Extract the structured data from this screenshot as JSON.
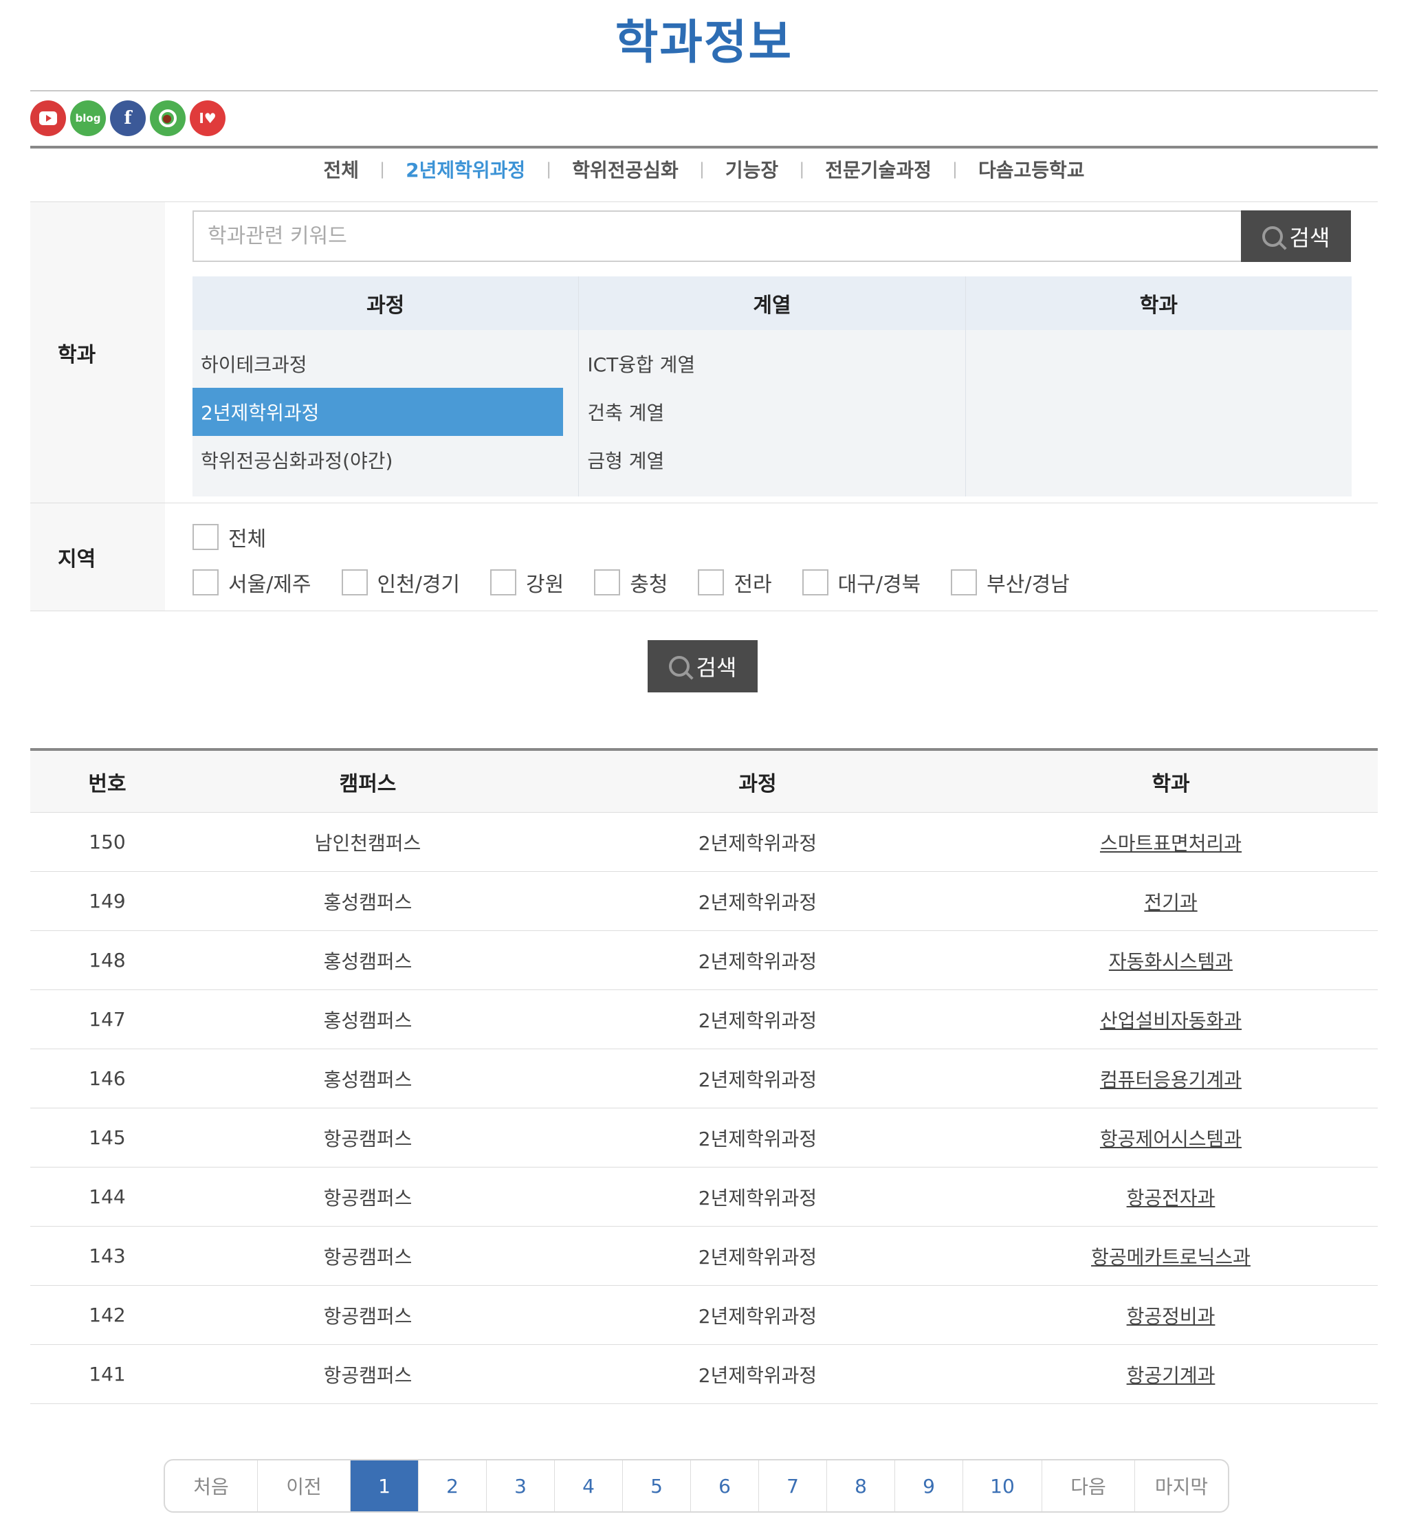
{
  "page": {
    "title": "학과정보"
  },
  "sns": [
    "youtube-icon",
    "blog-icon",
    "facebook-icon",
    "kakaostory-icon",
    "ilove-icon"
  ],
  "sns_labels": {
    "blog": "blog",
    "facebook": "f",
    "ilove": "I♥"
  },
  "tabs": [
    {
      "label": "전체",
      "active": false
    },
    {
      "label": "2년제학위과정",
      "active": true
    },
    {
      "label": "학위전공심화",
      "active": false
    },
    {
      "label": "기능장",
      "active": false
    },
    {
      "label": "전문기술과정",
      "active": false
    },
    {
      "label": "다솜고등학교",
      "active": false
    }
  ],
  "tab_separator": "|",
  "filter": {
    "dept_label": "학과",
    "region_label": "지역",
    "keyword_placeholder": "학과관련 키워드",
    "search_label": "검색",
    "columns": {
      "course": "과정",
      "field": "계열",
      "dept": "학과"
    },
    "courses": [
      {
        "label": "하이테크과정",
        "selected": false
      },
      {
        "label": "2년제학위과정",
        "selected": true
      },
      {
        "label": "학위전공심화과정(야간)",
        "selected": false
      }
    ],
    "fields": [
      "ICT융합 계열",
      "건축 계열",
      "금형 계열"
    ],
    "regions_all": "전체",
    "regions": [
      "서울/제주",
      "인천/경기",
      "강원",
      "충청",
      "전라",
      "대구/경북",
      "부산/경남"
    ]
  },
  "main_search_label": "검색",
  "table": {
    "headers": {
      "no": "번호",
      "campus": "캠퍼스",
      "course": "과정",
      "dept": "학과"
    },
    "rows": [
      {
        "no": "150",
        "campus": "남인천캠퍼스",
        "course": "2년제학위과정",
        "dept": "스마트표면처리과"
      },
      {
        "no": "149",
        "campus": "홍성캠퍼스",
        "course": "2년제학위과정",
        "dept": "전기과"
      },
      {
        "no": "148",
        "campus": "홍성캠퍼스",
        "course": "2년제학위과정",
        "dept": "자동화시스템과"
      },
      {
        "no": "147",
        "campus": "홍성캠퍼스",
        "course": "2년제학위과정",
        "dept": "산업설비자동화과"
      },
      {
        "no": "146",
        "campus": "홍성캠퍼스",
        "course": "2년제학위과정",
        "dept": "컴퓨터응용기계과"
      },
      {
        "no": "145",
        "campus": "항공캠퍼스",
        "course": "2년제학위과정",
        "dept": "항공제어시스템과"
      },
      {
        "no": "144",
        "campus": "항공캠퍼스",
        "course": "2년제학위과정",
        "dept": "항공전자과"
      },
      {
        "no": "143",
        "campus": "항공캠퍼스",
        "course": "2년제학위과정",
        "dept": "항공메카트로닉스과"
      },
      {
        "no": "142",
        "campus": "항공캠퍼스",
        "course": "2년제학위과정",
        "dept": "항공정비과"
      },
      {
        "no": "141",
        "campus": "항공캠퍼스",
        "course": "2년제학위과정",
        "dept": "항공기계과"
      }
    ]
  },
  "pagination": {
    "first": "처음",
    "prev": "이전",
    "pages": [
      "1",
      "2",
      "3",
      "4",
      "5",
      "6",
      "7",
      "8",
      "9",
      "10"
    ],
    "current": "1",
    "next": "다음",
    "last": "마지막"
  },
  "colors": {
    "accent": "#2d6db4",
    "active_tab": "#3c93d6",
    "selected_item": "#4a9ad6",
    "button": "#4a4a4a"
  }
}
